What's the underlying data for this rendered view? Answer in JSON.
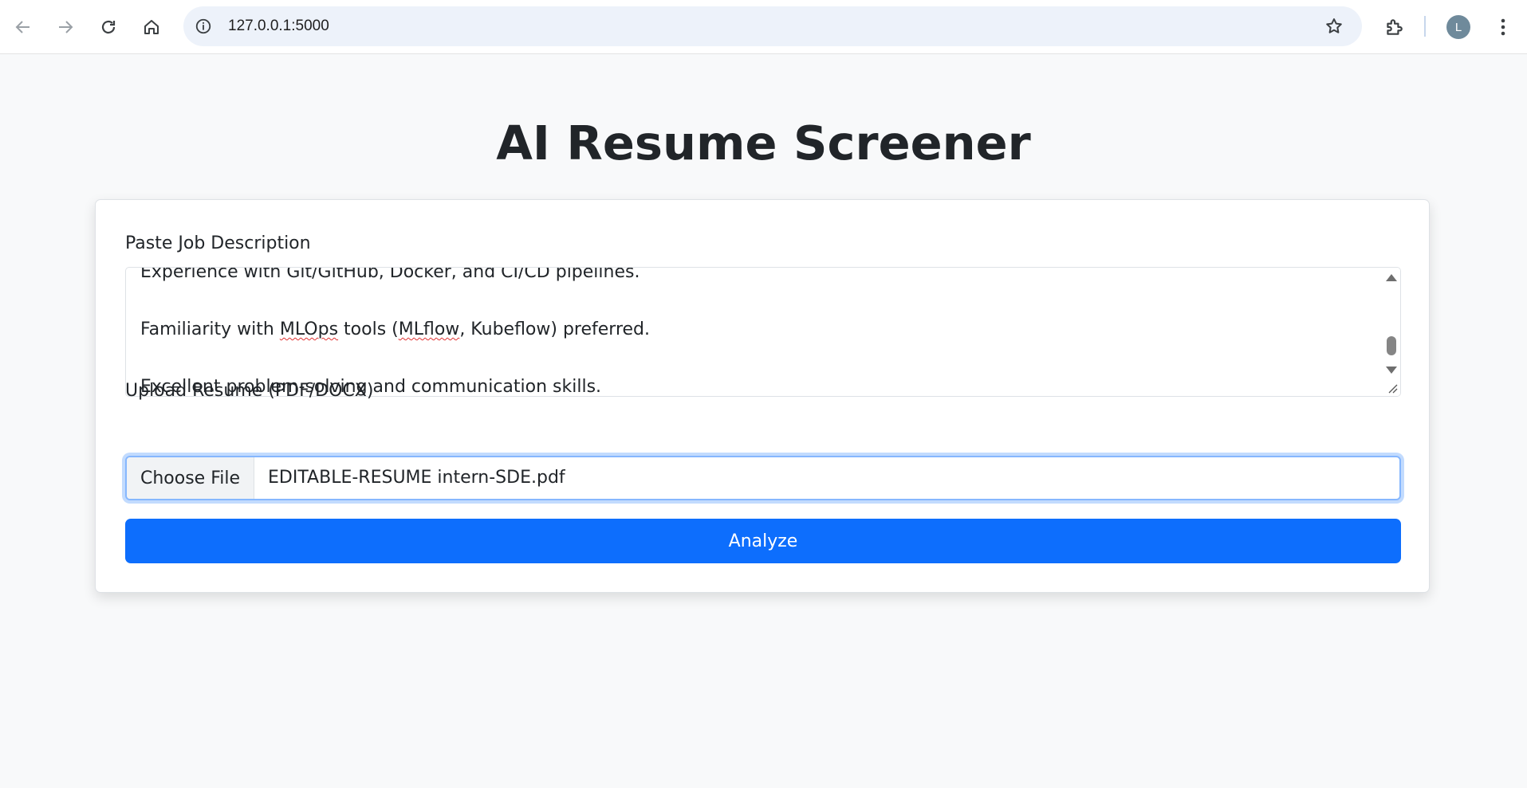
{
  "browser": {
    "url": "127.0.0.1:5000",
    "avatar_letter": "L",
    "icons": [
      "back-arrow-icon",
      "forward-arrow-icon",
      "reload-icon",
      "home-icon",
      "site-info-icon",
      "bookmark-star-icon",
      "extensions-icon",
      "more-menu-icon"
    ]
  },
  "page": {
    "title": "AI Resume Screener",
    "job_label": "Paste Job Description",
    "job_lines": [
      "Experience with Git/GitHub, Docker, and CI/CD pipelines.",
      "",
      "Familiarity with MLOps tools (MLflow, Kubeflow) preferred.",
      "",
      "Excellent problem-solving and communication skills."
    ],
    "resume_label": "Upload Resume (PDF/DOCX)",
    "choose_file_label": "Choose File",
    "file_name": "EDITABLE-RESUME intern-SDE.pdf",
    "analyze_label": "Analyze"
  },
  "colors": {
    "primary": "#0d6efd",
    "background": "#f8f9fa",
    "focus_ring": "#86b7fe"
  }
}
